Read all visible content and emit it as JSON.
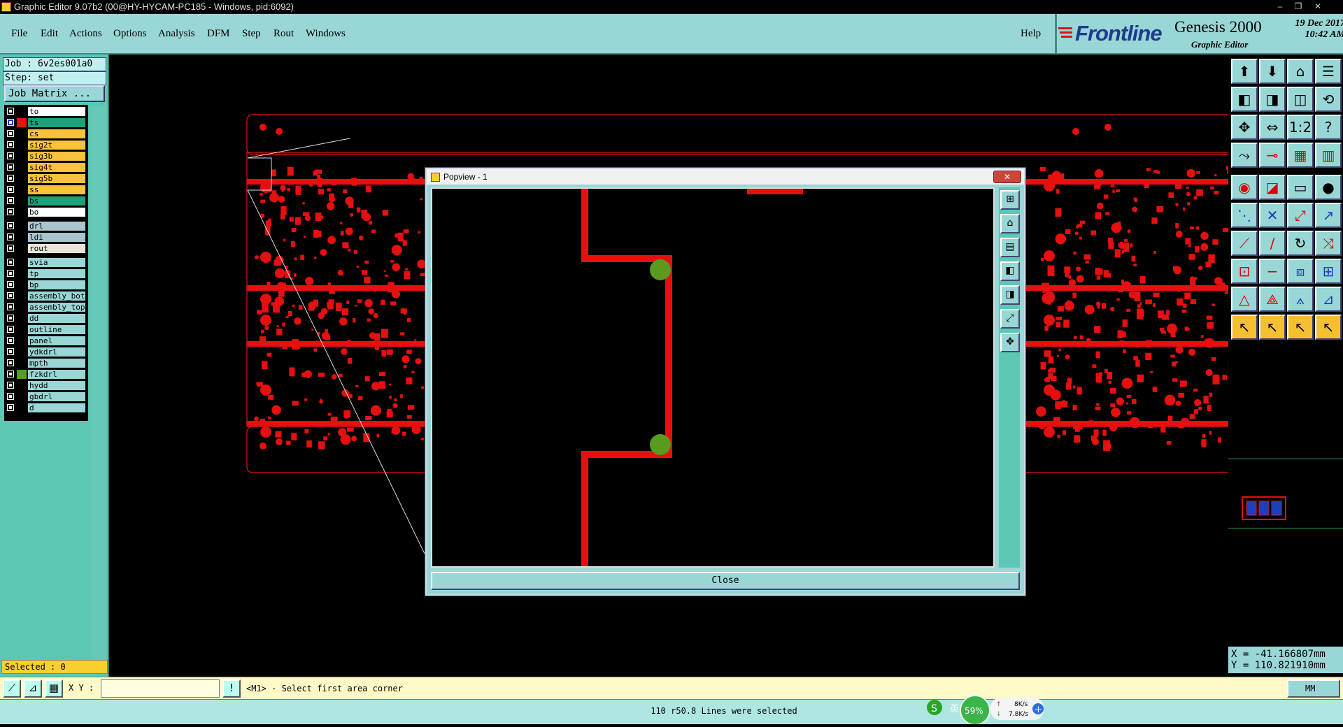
{
  "window": {
    "title": "Graphic Editor 9.07b2 (00@HY-HYCAM-PC185 - Windows, pid:6092)",
    "controls": [
      "–",
      "❐",
      "✕"
    ]
  },
  "menu": {
    "items": [
      "File",
      "Edit",
      "Actions",
      "Options",
      "Analysis",
      "DFM",
      "Step",
      "Rout",
      "Windows"
    ],
    "help": "Help"
  },
  "brand": {
    "logo": "Frontline",
    "product": "Genesis 2000",
    "subtitle": "Graphic Editor",
    "date": "19 Dec 2017",
    "time": "10:42 AM"
  },
  "job": {
    "job_line": "Job : 6v2es001a0",
    "step_line": "Step: set",
    "job_matrix": "Job Matrix ..."
  },
  "layers": [
    {
      "name": "to",
      "color": "#ffffff",
      "swatch": "#000000"
    },
    {
      "name": "ts",
      "color": "#1aa37a",
      "swatch": "#ee1111",
      "selected": true
    },
    {
      "name": "cs",
      "color": "#f7c23c",
      "swatch": "#000000"
    },
    {
      "name": "sig2t",
      "color": "#f7c23c",
      "swatch": "#000000"
    },
    {
      "name": "sig3b",
      "color": "#f7c23c",
      "swatch": "#000000"
    },
    {
      "name": "sig4t",
      "color": "#f7c23c",
      "swatch": "#000000"
    },
    {
      "name": "sig5b",
      "color": "#f7c23c",
      "swatch": "#000000"
    },
    {
      "name": "ss",
      "color": "#f7c23c",
      "swatch": "#000000"
    },
    {
      "name": "bs",
      "color": "#1aa37a",
      "swatch": "#000000"
    },
    {
      "name": "bo",
      "color": "#ffffff",
      "swatch": "#000000"
    },
    {
      "name": "drl",
      "color": "#a9c6d0",
      "swatch": "#000000",
      "gap": true
    },
    {
      "name": "ldi",
      "color": "#a9c6d0",
      "swatch": "#000000"
    },
    {
      "name": "rout",
      "color": "#e8e4d8",
      "swatch": "#000000"
    },
    {
      "name": "svia",
      "color": "#99d6d6",
      "swatch": "#000000",
      "gap": true
    },
    {
      "name": "tp",
      "color": "#99d6d6",
      "swatch": "#000000"
    },
    {
      "name": "bp",
      "color": "#99d6d6",
      "swatch": "#000000"
    },
    {
      "name": "assembly_bot",
      "color": "#99d6d6",
      "swatch": "#000000"
    },
    {
      "name": "assembly_top",
      "color": "#99d6d6",
      "swatch": "#000000"
    },
    {
      "name": "dd",
      "color": "#99d6d6",
      "swatch": "#000000"
    },
    {
      "name": "outline",
      "color": "#99d6d6",
      "swatch": "#000000"
    },
    {
      "name": "panel",
      "color": "#99d6d6",
      "swatch": "#000000"
    },
    {
      "name": "ydkdrl",
      "color": "#99d6d6",
      "swatch": "#000000"
    },
    {
      "name": "mpth",
      "color": "#99d6d6",
      "swatch": "#000000"
    },
    {
      "name": "fzkdrl",
      "color": "#99d6d6",
      "swatch": "#55a020"
    },
    {
      "name": "hydd",
      "color": "#99d6d6",
      "swatch": "#000000"
    },
    {
      "name": "gbdrl",
      "color": "#99d6d6",
      "swatch": "#000000"
    },
    {
      "name": "d",
      "color": "#99d6d6",
      "swatch": "#000000"
    }
  ],
  "selected_text": "Selected : 0",
  "status": {
    "xy_label": "X Y :",
    "prompt": "<M1> - Select first area corner",
    "units": "MM",
    "message": "110 r50.8 Lines were selected"
  },
  "coords": {
    "x": "X = -41.166807mm",
    "y": "Y = 110.821910mm"
  },
  "popview": {
    "title": "Popview - 1",
    "close": "Close",
    "title_close": "✕"
  },
  "tray": {
    "ime": "英",
    "percent": "59%",
    "up": "8K/s",
    "down": "7.8K/s"
  },
  "toolbar_icons": [
    "zoom-home-icon",
    "zoom-in-icon",
    "home-icon",
    "zoom-fit-icon",
    "pan-left-icon",
    "pan-right-icon",
    "zoom-area-icon",
    "redraw-icon",
    "center-icon",
    "fit-width-icon",
    "scale-1-2-icon",
    "help-icon",
    "snap-icon",
    "pad-icon",
    "layer-multi-icon",
    "layer-stack-icon",
    "add-pad-icon",
    "add-line-icon",
    "ruler-icon",
    "circle-icon",
    "net-icon",
    "cross-icon",
    "connect-icon",
    "arc-icon",
    "edit-line-icon",
    "slash-icon",
    "rotate-icon",
    "route-icon",
    "move-icon",
    "minus-icon",
    "resize-icon",
    "copy-icon",
    "triangle-icon",
    "outline-icon",
    "arc-tri-icon",
    "angle-icon",
    "pointer-icon",
    "select-icon",
    "select-area-icon",
    "select-multi-icon"
  ],
  "colors": {
    "accent": "#99d6d6",
    "board": "#e61010",
    "highlight": "#5a9a1e"
  }
}
